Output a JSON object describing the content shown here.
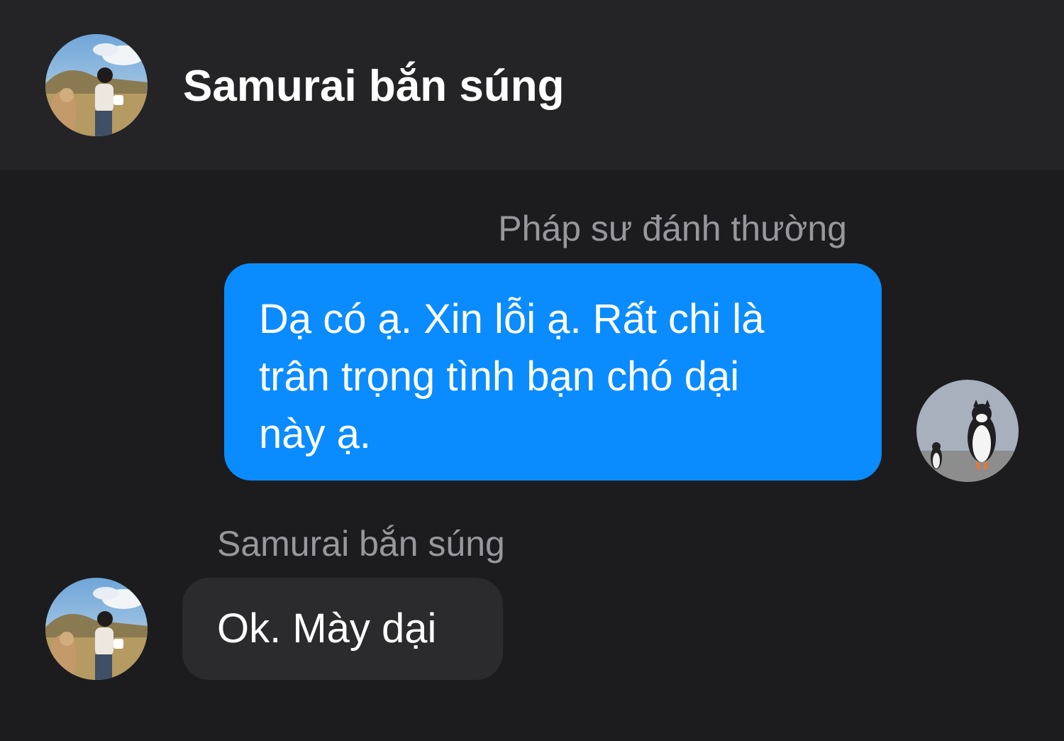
{
  "header": {
    "title": "Samurai bắn súng"
  },
  "messages": [
    {
      "direction": "outgoing",
      "sender": "Pháp sư đánh thường",
      "text": "Dạ có ạ. Xin lỗi ạ. Rất chi là\ntrân trọng tình bạn chó dại\nnày ạ.",
      "bubble_color": "#0a8cfe",
      "avatar_icon": "penguin-cat-photo-avatar-icon"
    },
    {
      "direction": "incoming",
      "sender": "Samurai bắn súng",
      "text": "Ok. Mày dại",
      "bubble_color": "#2b2b2d",
      "avatar_icon": "person-with-alpaca-photo-avatar-icon"
    }
  ],
  "colors": {
    "background": "#1c1c1e",
    "header_background": "#242426",
    "sender_label": "#98979c",
    "text": "#ffffff"
  }
}
